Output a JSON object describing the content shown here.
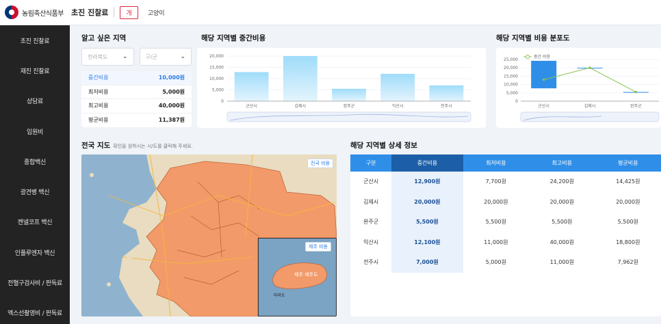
{
  "header": {
    "logo_text": "농림축산식품부",
    "page_title": "초진 진찰료",
    "pets": [
      "개",
      "고양이"
    ]
  },
  "sidebar": {
    "items": [
      "초진 진찰료",
      "재진 진찰료",
      "상담료",
      "입원비",
      "종합백신",
      "광견병 백신",
      "켄넬코프 백신",
      "인플루엔자 백신",
      "전혈구검사비 / 판독료",
      "엑스선촬영비 / 판독료"
    ]
  },
  "region": {
    "title": "알고 싶은 지역",
    "province": "전라북도",
    "district_placeholder": "구/군",
    "summary": [
      {
        "label": "중간비용",
        "value": "10,000원"
      },
      {
        "label": "최저비용",
        "value": "5,000원"
      },
      {
        "label": "최고비용",
        "value": "40,000원"
      },
      {
        "label": "평균비용",
        "value": "11,387원"
      }
    ]
  },
  "median_chart_title": "해당 지역별 중간비용",
  "dist_chart_title": "해당 지역별 비용 분포도",
  "map": {
    "title": "전국 지도",
    "hint": "확인을 원하시는 시/도를 클릭해 주세요.",
    "nation_btn": "전국 비용",
    "jeju_btn": "제주 비용",
    "jeju_label": "제주 제주도",
    "mara_label": "마라도"
  },
  "detail": {
    "title": "해당 지역별 상세 정보",
    "columns": [
      "구분",
      "중간비용",
      "최저비용",
      "최고비용",
      "평균비용"
    ],
    "rows": [
      [
        "군산시",
        "12,900원",
        "7,700원",
        "24,200원",
        "14,425원"
      ],
      [
        "김제시",
        "20,000원",
        "20,000원",
        "20,000원",
        "20,000원"
      ],
      [
        "완주군",
        "5,500원",
        "5,500원",
        "5,500원",
        "5,500원"
      ],
      [
        "익산시",
        "12,100원",
        "11,000원",
        "40,000원",
        "18,800원"
      ],
      [
        "전주시",
        "7,000원",
        "5,000원",
        "11,000원",
        "7,962원"
      ]
    ]
  },
  "chart_data": [
    {
      "type": "bar",
      "categories": [
        "군산시",
        "김제시",
        "완주군",
        "익산시",
        "전주시"
      ],
      "values": [
        12900,
        20000,
        5500,
        12100,
        7000
      ],
      "ylim": [
        0,
        20000
      ],
      "yticks": [
        "0",
        "5,000",
        "10,000",
        "15,000",
        "20,000"
      ],
      "grid": true,
      "color": "#8fd0f5"
    },
    {
      "type": "bar",
      "categories": [
        "군산시",
        "김제시",
        "완주군"
      ],
      "series": [
        {
          "name": "중간 비용",
          "values": [
            12900,
            20000,
            5500
          ]
        }
      ],
      "ranges": [
        [
          7700,
          24200
        ],
        [
          20000,
          20000
        ],
        [
          5500,
          5500
        ]
      ],
      "ylim": [
        0,
        25000
      ],
      "yticks": [
        "0",
        "5,000",
        "10,000",
        "15,000",
        "20,000",
        "25,000"
      ],
      "legend": "top-left",
      "colors": {
        "range": "#2f8fe8",
        "median": "#8cc152"
      }
    }
  ]
}
